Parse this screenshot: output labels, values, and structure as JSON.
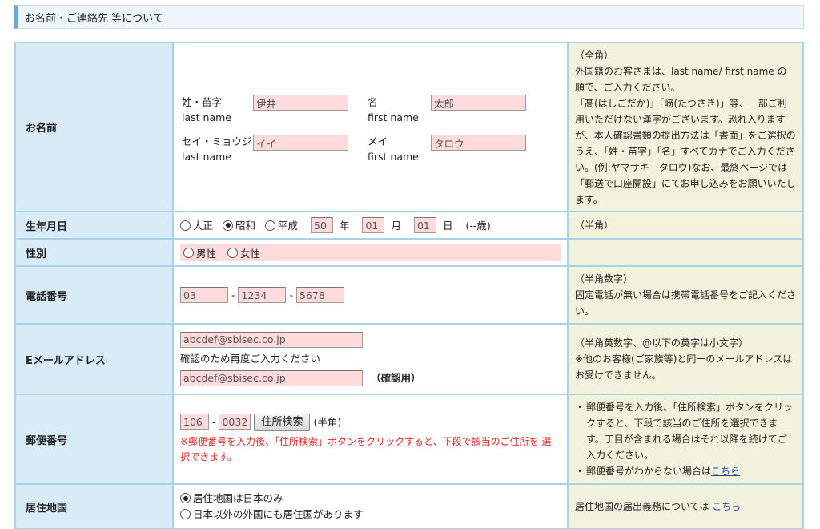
{
  "section_title": "お名前・ご連絡先 等について",
  "rows": {
    "name": {
      "label": "お名前",
      "surname_label": "姓・苗字",
      "surname_sub": "last name",
      "surname_value": "伊井",
      "given_label": "名",
      "given_sub": "first name",
      "given_value": "太郎",
      "surname_kana_label": "セイ・ミョウジ",
      "surname_kana_sub": "last name",
      "surname_kana_value": "イイ",
      "given_kana_label": "メイ",
      "given_kana_sub": "first name",
      "given_kana_value": "タロウ",
      "note": "（全角）\n外国籍のお客さまは、last name/ first name の順で、ご入力ください。\n「髙(はしごだか)」「﨑(たつさき)」等、一部ご利用いただけない漢字がございます。恐れ入りますが、本人確認書類の提出方法は「書面」をご選択のうえ、「姓・苗字」「名」すべてカナでご入力ください。(例:ヤマサキ　タロウ)なお、最終ページでは「郵送で口座開設」にてお申し込みをお願いいたします。"
    },
    "birth": {
      "label": "生年月日",
      "era_taisho": "大正",
      "era_showa": "昭和",
      "era_heisei": "平成",
      "year": "50",
      "year_unit": "年",
      "month": "01",
      "month_unit": "月",
      "day": "01",
      "day_unit": "日",
      "age": "(--歳)",
      "note": "（半角）"
    },
    "gender": {
      "label": "性別",
      "male": "男性",
      "female": "女性"
    },
    "phone": {
      "label": "電話番号",
      "part1": "03",
      "part2": "1234",
      "part3": "5678",
      "sep": "-",
      "note": "（半角数字）\n固定電話が無い場合は携帯電話番号をご記入ください。"
    },
    "email": {
      "label": "Eメールアドレス",
      "value": "abcdef@sbisec.co.jp",
      "confirm_text": "確認のため再度ご入力ください",
      "confirm_value": "abcdef@sbisec.co.jp",
      "confirm_suffix": "（確認用）",
      "note": "（半角英数字、@以下の英字は小文字）\n※他のお客様(ご家族等)と同一のメールアドレスはお受けできません。"
    },
    "postal": {
      "label": "郵便番号",
      "part1": "106",
      "part2": "0032",
      "sep": "-",
      "search_button": "住所検索",
      "hankaku": "(半角)",
      "warning": "※郵便番号を入力後、「住所検索」ボタンをクリックすると、下段で該当のご住所を 選択できます。",
      "note_item1": "郵便番号を入力後、「住所検索」ボタンをクリックすると、下段で該当のご住所を選択できます。丁目が含まれる場合はそれ以降を続けてご入力ください。",
      "note_item2": "郵便番号がわからない場合は",
      "note_link": "こちら"
    },
    "residence": {
      "label": "居住地国",
      "opt_japan": "居住地国は日本のみ",
      "opt_other": "日本以外の外国にも居住国があります",
      "note_text": "居住地国の届出義務については ",
      "note_link": "こちら"
    }
  }
}
